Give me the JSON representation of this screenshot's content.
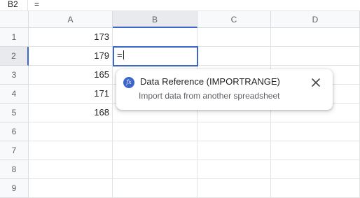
{
  "formula_bar": {
    "cell_ref": "B2",
    "content": "="
  },
  "columns": [
    "A",
    "B",
    "C",
    "D"
  ],
  "rows": [
    "1",
    "2",
    "3",
    "4",
    "5",
    "6",
    "7",
    "8",
    "9"
  ],
  "cells": {
    "A1": "173",
    "A2": "179",
    "A3": "165",
    "A4": "171",
    "A5": "168"
  },
  "active_cell": {
    "ref": "B2",
    "value": "="
  },
  "suggestion": {
    "icon": "fx-icon",
    "icon_text": "fx",
    "title": "Data Reference (IMPORTRANGE)",
    "subtitle": "Import data from another spreadsheet",
    "close_icon": "close-icon"
  },
  "colors": {
    "accent": "#3c67c8",
    "header_bg": "#f8f9fa",
    "gridline": "#e2e3e3"
  }
}
